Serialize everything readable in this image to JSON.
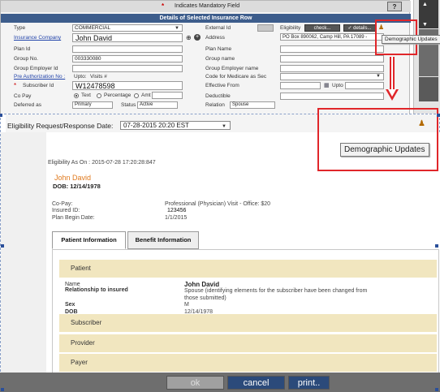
{
  "top_form": {
    "mandatory_label": "Indicates Mandatory Field",
    "help_label": "?",
    "section_title": "Details of Selected Insurance Row",
    "left": {
      "type_label": "Type",
      "type_value": "COMMERCIAL",
      "insurance_company_label": "Insurance Company",
      "insurance_company_value": "John David",
      "plan_id_label": "Plan Id",
      "group_no_label": "Group No.",
      "group_no_value": "003330080",
      "group_employer_id_label": "Group Employer Id",
      "pre_auth_label": "Pre Authorization No :",
      "upto_label": "Upto:",
      "visits_label": "Visits #",
      "subscriber_id_label": "Subscriber Id",
      "subscriber_id_value": "W12478598",
      "copay_label": "Co Pay",
      "copay_options": [
        "Text",
        "Percentage",
        "Amt"
      ],
      "deferred_label": "Deferred as",
      "deferred_value": "Primary",
      "status_label": "Status",
      "status_value": "Active"
    },
    "right": {
      "external_id_label": "External Id",
      "eligibility_label": "Eligibility",
      "check_button": "check...",
      "details_button": "✓ details...",
      "address_label": "Address",
      "address_value": "PO Box 890062, Camp Hill, PA 17089 -",
      "plan_name_label": "Plan Name",
      "group_name_label": "Group name",
      "group_employer_name_label": "Group Employer name",
      "medicare_code_label": "Code for Medicare as Sec",
      "effective_from_label": "Effective From",
      "upto_label": "Upto",
      "deductible_label": "Deductible",
      "relation_label": "Relation",
      "relation_value": "Spouse"
    },
    "tooltip": "Demographic Updates"
  },
  "eligibility": {
    "date_label": "Eligibility Request/Response Date:",
    "date_value": "07-28-2015 20:20 EST",
    "tooltip": "Demographic Updates",
    "as_on": "Eligibility As On : 2015-07-28 17:20:28:847",
    "patient_name": "John David",
    "patient_dob": "DOB: 12/14/1978",
    "details": [
      {
        "label": "Co-Pay:",
        "value": "Professional (Physician) Visit - Office: $20"
      },
      {
        "label": "Insured ID:",
        "value": "123456"
      },
      {
        "label": "Plan Begin Date:",
        "value": "1/1/2015"
      }
    ],
    "tabs": [
      "Patient Information",
      "Benefit Information"
    ],
    "sections": {
      "patient": "Patient",
      "subscriber": "Subscriber",
      "provider": "Provider",
      "payer": "Payer"
    },
    "patient_rows": [
      {
        "label": "Name",
        "value": "John David"
      },
      {
        "label": "Relationship to insured",
        "value": "Spouse (identifying elements for the subscriber have been changed from those submitted)"
      },
      {
        "label": "Sex",
        "value": "M"
      },
      {
        "label": "DOB",
        "value": "12/14/1978"
      }
    ]
  },
  "buttons": {
    "ok": "ok",
    "cancel": "cancel",
    "print": "print.."
  },
  "colors": {
    "highlight": "#e0262a",
    "header_blue": "#3d5d8c",
    "section_tan": "#f1e6bf",
    "patient_orange": "#e07a1e"
  }
}
